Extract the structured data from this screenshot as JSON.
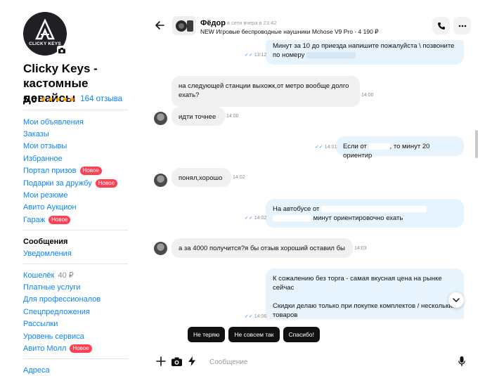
{
  "sidebar": {
    "avatar_text": "CLICKY KEYS",
    "shop_name": "Clicky Keys - кастомные девайсы",
    "rating": "5,0",
    "stars": "★★★★★",
    "reviews": "164 отзыва",
    "menu1": [
      {
        "label": "Мои объявления"
      },
      {
        "label": "Заказы"
      },
      {
        "label": "Мои отзывы"
      },
      {
        "label": "Избранное"
      },
      {
        "label": "Портал призов",
        "badge": "Новое"
      },
      {
        "label": "Подарки за дружбу",
        "badge": "Новое"
      },
      {
        "label": "Мои резюме"
      },
      {
        "label": "Авито Аукцион"
      },
      {
        "label": "Гараж",
        "badge": "Новое"
      }
    ],
    "menu2": [
      {
        "label": "Сообщения"
      },
      {
        "label": "Уведомления"
      }
    ],
    "menu3": [
      {
        "label": "Кошелёк",
        "muted": "40 ₽"
      },
      {
        "label": "Платные услуги"
      },
      {
        "label": "Для профессионалов"
      },
      {
        "label": "Спецпредложения"
      },
      {
        "label": "Рассылки"
      },
      {
        "label": "Уровень сервиса"
      },
      {
        "label": "Авито Молл",
        "badge": "Новое"
      }
    ],
    "menu4": [
      {
        "label": "Адреса"
      }
    ]
  },
  "header": {
    "contact_name": "Фёдор",
    "status": "в сети вчера в 23:42",
    "product": "NEW Игровые беспроводные наушники Mchose V9 Pro · 4 190 ₽"
  },
  "messages": {
    "m1_text": "Минут за 10 до приезда напишите пожалуйста \\ позвоните по номеру",
    "m1_time": "13:12",
    "m2_text": "на следующей станции выхожк,от метро вообще долго ехать?",
    "m2_time": "14:00",
    "m3_text": "идти точнее",
    "m3_time": "14:00",
    "m4_a": "Если от",
    "m4_b": ", то минут 20 ориентир",
    "m4_time": "14:01",
    "m5_text": "понял,хорошо",
    "m5_time": "14:02",
    "m6_a": "На автобусе от",
    "m6_b": "минут ориентировочно ехать",
    "m6_time": "14:02",
    "m7_text": "а за 4000 получится?я бы отзыв хороший оставил бы",
    "m7_time": "14:03",
    "m8_p1": "К сожалению без торга - самая вкусная цена на рынке сейчас",
    "m8_p2": "Скидки делаю только при покупке комплектов / нескольких товаров",
    "m8_time": "14:06"
  },
  "quick_replies": [
    "Не теряю",
    "Не совсем так",
    "Спасибо!"
  ],
  "composer": {
    "placeholder": "Сообщение"
  },
  "icons": [
    "back-arrow-icon",
    "phone-icon",
    "more-icon",
    "plus-icon",
    "camera-icon",
    "lightning-icon",
    "microphone-icon",
    "chevron-down-icon"
  ],
  "colors": {
    "link": "#0a84ff",
    "badge": "#ff4053",
    "outgoing": "#e8f4fd",
    "incoming": "#f0f0f0",
    "star": "#ffa000"
  }
}
